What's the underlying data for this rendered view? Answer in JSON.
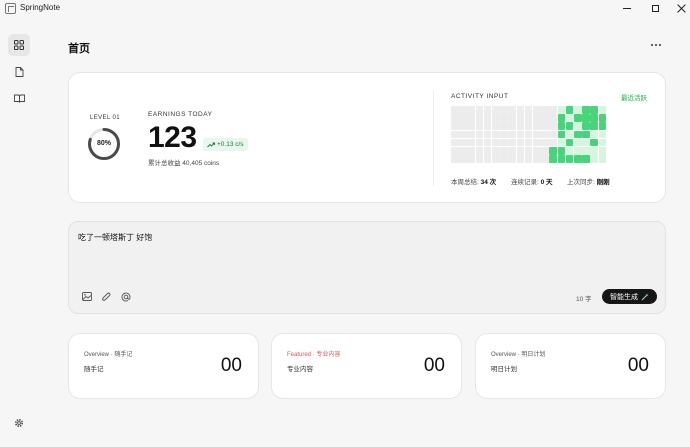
{
  "app": {
    "title": "SpringNote"
  },
  "header": {
    "title": "首页"
  },
  "level": {
    "label": "LEVEL 01",
    "percent": 80,
    "percent_text": "80%"
  },
  "earnings": {
    "label": "EARNINGS TODAY",
    "value": "123",
    "rate": "+0.13 c/s",
    "total": "累计总收益 40,405 coins"
  },
  "activity": {
    "label": "ACTIVITY INPUT",
    "tag": "最近活跃",
    "weekly_label": "本周总结:",
    "weekly_value": "34 次",
    "streak_label": "连续记录:",
    "streak_value": "0 天",
    "sync_label": "上次同步:",
    "sync_value": "刚刚",
    "colors": {
      "0": "#ececec",
      "1": "#d6f5df",
      "2": "#47d47a"
    },
    "grid": [
      [
        0,
        0,
        0,
        0,
        0,
        0,
        0,
        0,
        0,
        0,
        0,
        0,
        0,
        1,
        2,
        1,
        2,
        2,
        1
      ],
      [
        0,
        0,
        0,
        0,
        0,
        0,
        0,
        0,
        0,
        0,
        0,
        0,
        0,
        2,
        1,
        2,
        2,
        2,
        2
      ],
      [
        0,
        0,
        0,
        0,
        0,
        0,
        0,
        0,
        0,
        0,
        0,
        0,
        0,
        2,
        2,
        1,
        2,
        2,
        2
      ],
      [
        0,
        0,
        0,
        0,
        0,
        0,
        0,
        0,
        0,
        0,
        0,
        0,
        0,
        2,
        1,
        2,
        2,
        1,
        1
      ],
      [
        0,
        0,
        0,
        0,
        0,
        0,
        0,
        0,
        0,
        0,
        0,
        0,
        0,
        1,
        2,
        1,
        1,
        2,
        1
      ],
      [
        0,
        0,
        0,
        0,
        0,
        0,
        0,
        0,
        0,
        0,
        0,
        0,
        2,
        2,
        1,
        1,
        1,
        1,
        1
      ],
      [
        0,
        0,
        0,
        0,
        0,
        0,
        0,
        0,
        0,
        0,
        0,
        0,
        2,
        2,
        2,
        2,
        2,
        1,
        1
      ]
    ]
  },
  "composer": {
    "text": "吃了一顿塔斯丁 好饱",
    "char_count": "10 字",
    "generate_label": "智能生成"
  },
  "cards": [
    {
      "tag": "Overview · 随手记",
      "name": "随手记",
      "count": "00",
      "featured": false
    },
    {
      "tag": "Featured · 专业内容",
      "name": "专业内容",
      "count": "00",
      "featured": true
    },
    {
      "tag": "Overview · 明日计划",
      "name": "明日计划",
      "count": "00",
      "featured": false
    }
  ]
}
